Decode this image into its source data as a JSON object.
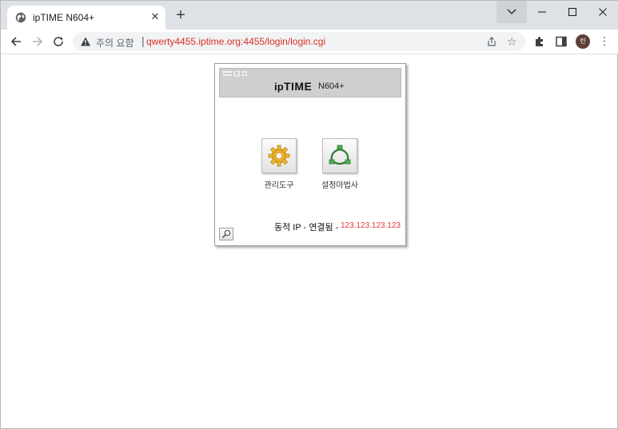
{
  "browser": {
    "tab": {
      "title": "ipTIME N604+",
      "favicon": "globe-icon"
    },
    "window_controls": [
      "chevron-down-icon",
      "minimize-icon",
      "maximize-icon",
      "close-icon"
    ],
    "address": {
      "security_text": "주의 요함",
      "url": "qwerty4455.iptime.org:4455/login/login.cgi"
    },
    "profile_initial": "린"
  },
  "router": {
    "brand": {
      "prefix": "ip",
      "middle": "TIME",
      "model": "N604+"
    },
    "tools": [
      {
        "label": "관리도구",
        "icon": "gear-icon"
      },
      {
        "label": "설정마법사",
        "icon": "network-wizard-icon"
      }
    ],
    "status": {
      "label": "동적 IP - 연결됨 -",
      "ip": "123.123.123.123"
    }
  },
  "colors": {
    "url_warning": "#d93025",
    "status_ip": "#e53935",
    "banner": "#cfcfcf",
    "tabstrip": "#dee1e6"
  }
}
